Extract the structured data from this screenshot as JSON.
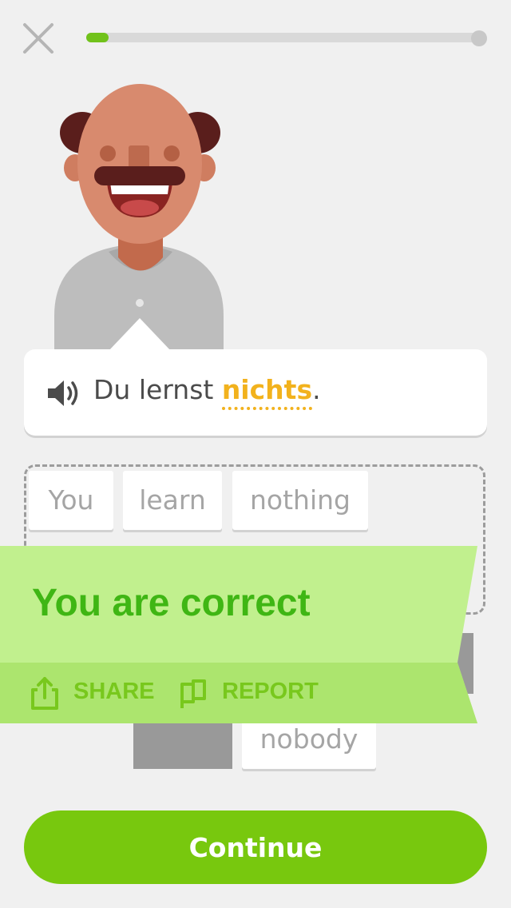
{
  "header": {
    "close_icon": "close-icon",
    "progress": 0.05
  },
  "prompt": {
    "audio_icon": "speaker-icon",
    "before": "Du lernst ",
    "highlight": "nichts",
    "after": "."
  },
  "answer": {
    "selected": [
      "You",
      "learn",
      "nothing"
    ]
  },
  "word_bank": {
    "remaining": [
      "nobody"
    ]
  },
  "feedback": {
    "title": "You are correct",
    "share_label": "SHARE",
    "report_label": "REPORT",
    "share_icon": "share-icon",
    "report_icon": "flag-icon"
  },
  "footer": {
    "continue_label": "Continue"
  },
  "colors": {
    "accent_green": "#78c80e",
    "banner_light": "#c1f08e",
    "highlight_yellow": "#f2b21d"
  }
}
